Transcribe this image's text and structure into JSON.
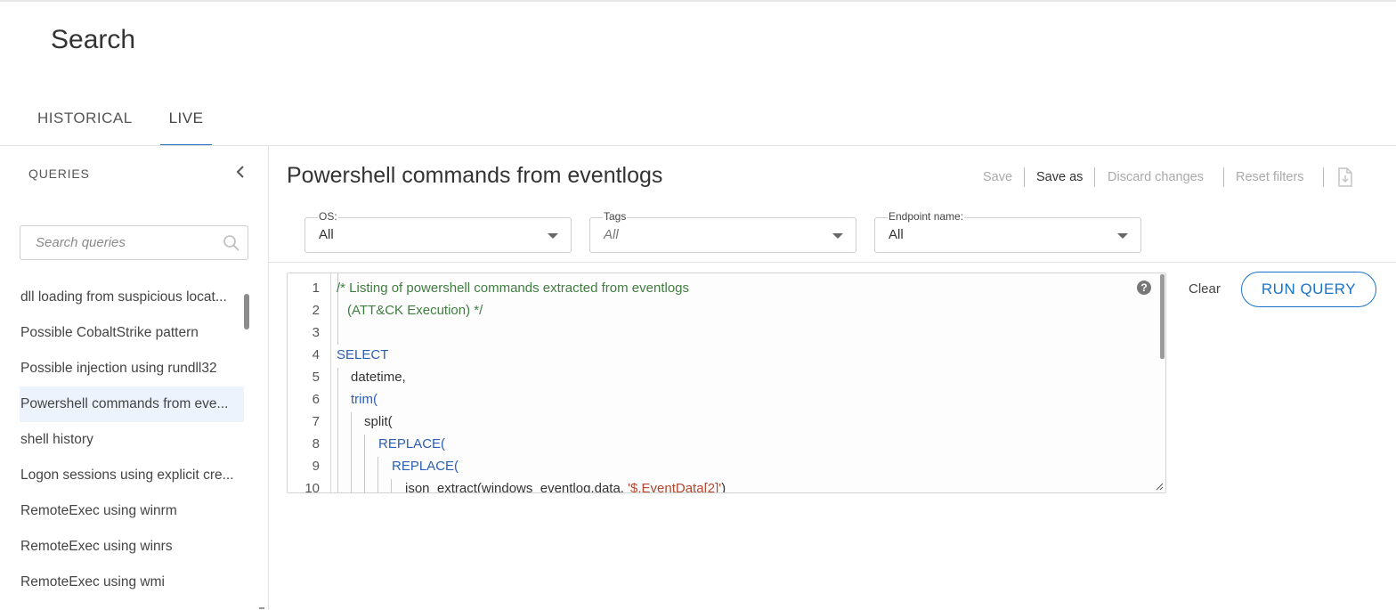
{
  "page": {
    "title": "Search"
  },
  "tabs": [
    {
      "label": "HISTORICAL",
      "active": false
    },
    {
      "label": "LIVE",
      "active": true
    }
  ],
  "sidebar": {
    "heading": "QUERIES",
    "search": {
      "placeholder": "Search queries",
      "value": ""
    },
    "items": [
      {
        "label": "dll loading from suspicious locat...",
        "active": false
      },
      {
        "label": "Possible CobaltStrike pattern",
        "active": false
      },
      {
        "label": "Possible injection using rundll32",
        "active": false
      },
      {
        "label": "Powershell commands from eve...",
        "active": true
      },
      {
        "label": "shell history",
        "active": false
      },
      {
        "label": "Logon sessions using explicit cre...",
        "active": false
      },
      {
        "label": "RemoteExec using winrm",
        "active": false
      },
      {
        "label": "RemoteExec using winrs",
        "active": false
      },
      {
        "label": "RemoteExec using wmi",
        "active": false
      }
    ]
  },
  "main": {
    "query_title": "Powershell commands from eventlogs",
    "actions": {
      "save": "Save",
      "save_as": "Save as",
      "discard": "Discard changes",
      "reset": "Reset filters"
    },
    "filters": {
      "os": {
        "label": "OS:",
        "value": "All"
      },
      "tags": {
        "label": "Tags",
        "value": "All"
      },
      "endpoint": {
        "label": "Endpoint name:",
        "value": "All"
      }
    },
    "editor": {
      "line_numbers": [
        "1",
        "2",
        "3",
        "4",
        "5",
        "6",
        "7",
        "8",
        "9",
        "10"
      ],
      "lines": {
        "l1": "/* Listing of powershell commands extracted from eventlogs",
        "l2": "(ATT&CK Execution) */",
        "l4": "SELECT",
        "l5": "datetime,",
        "l6": "trim(",
        "l7": "split(",
        "l8": "REPLACE(",
        "l9": "REPLACE(",
        "l10a": "json_extract(windows_eventlog.data, ",
        "l10b": "'$.EventData[2]'",
        "l10c": ")"
      }
    },
    "buttons": {
      "clear": "Clear",
      "run": "RUN QUERY"
    }
  },
  "colors": {
    "accent": "#1a73c7",
    "comment": "#3f7d3f",
    "keyword": "#2c5fb3",
    "string": "#b5462d",
    "selected_row": "#edf3fd"
  },
  "icons": [
    "chevron-left-icon",
    "search-icon",
    "chevron-down-icon",
    "export-icon",
    "help-icon",
    "resize-handle-icon"
  ]
}
